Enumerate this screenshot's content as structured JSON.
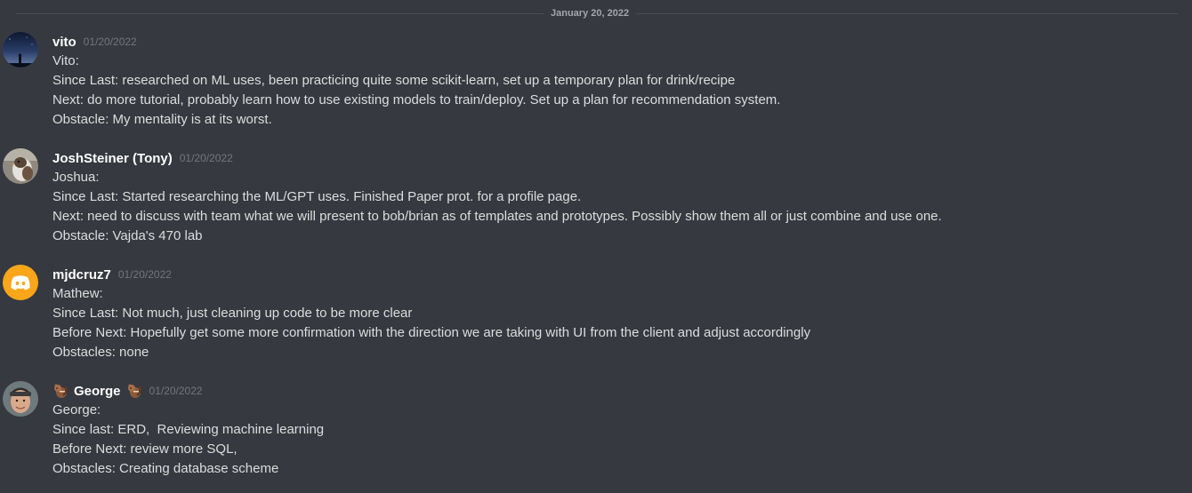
{
  "date_divider": "January 20, 2022",
  "messages": [
    {
      "username": "vito",
      "timestamp": "01/20/2022",
      "avatar": "night-sky-silhouette-avatar",
      "lines": [
        "Vito:",
        "Since Last: researched on ML uses, been practicing quite some scikit-learn, set up a temporary plan for drink/recipe",
        "Next: do more tutorial, probably learn how to use existing models to train/deploy. Set up a plan for recommendation system.",
        "Obstacle: My mentality is at its worst."
      ]
    },
    {
      "username": "JoshSteiner (Tony)",
      "timestamp": "01/20/2022",
      "avatar": "bird-photo-avatar",
      "lines": [
        "Joshua:",
        "Since Last: Started researching the ML/GPT uses. Finished Paper prot. for a profile page.",
        "Next: need to discuss with team what we will present to bob/brian as of templates and prototypes. Possibly show them all or just combine and use one.",
        "Obstacle: Vajda's 470 lab"
      ]
    },
    {
      "username": "mjdcruz7",
      "timestamp": "01/20/2022",
      "avatar": "discord-default-avatar",
      "lines": [
        "Mathew:",
        "Since Last: Not much, just cleaning up code to be more clear",
        "Before Next: Hopefully get some more confirmation with the direction we are taking with UI from the client and adjust accordingly",
        "Obstacles: none"
      ]
    },
    {
      "username": "George",
      "timestamp": "01/20/2022",
      "avatar": "person-photo-avatar",
      "name_emoji": "chipmunk-emoji",
      "lines": [
        "George:",
        "Since last: ERD,  Reviewing machine learning",
        "Before Next: review more SQL,",
        "Obstacles: Creating database scheme"
      ]
    }
  ],
  "colors": {
    "background": "#36393f",
    "username": "#ffffff",
    "timestamp": "#72767d",
    "text": "#dcddde",
    "discord_avatar_bg": "#faa61a"
  }
}
